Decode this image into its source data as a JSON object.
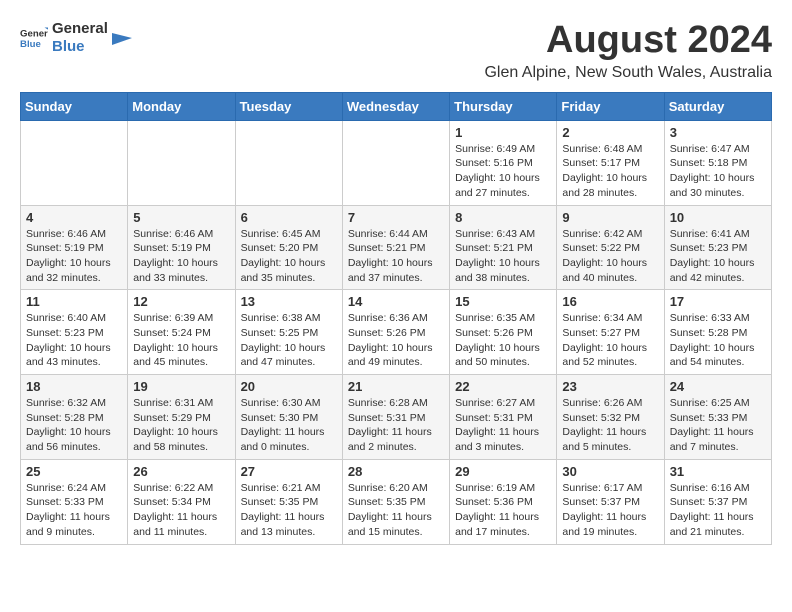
{
  "logo": {
    "line1": "General",
    "line2": "Blue"
  },
  "title": "August 2024",
  "subtitle": "Glen Alpine, New South Wales, Australia",
  "days_of_week": [
    "Sunday",
    "Monday",
    "Tuesday",
    "Wednesday",
    "Thursday",
    "Friday",
    "Saturday"
  ],
  "weeks": [
    [
      {
        "day": "",
        "info": ""
      },
      {
        "day": "",
        "info": ""
      },
      {
        "day": "",
        "info": ""
      },
      {
        "day": "",
        "info": ""
      },
      {
        "day": "1",
        "info": "Sunrise: 6:49 AM\nSunset: 5:16 PM\nDaylight: 10 hours\nand 27 minutes."
      },
      {
        "day": "2",
        "info": "Sunrise: 6:48 AM\nSunset: 5:17 PM\nDaylight: 10 hours\nand 28 minutes."
      },
      {
        "day": "3",
        "info": "Sunrise: 6:47 AM\nSunset: 5:18 PM\nDaylight: 10 hours\nand 30 minutes."
      }
    ],
    [
      {
        "day": "4",
        "info": "Sunrise: 6:46 AM\nSunset: 5:19 PM\nDaylight: 10 hours\nand 32 minutes."
      },
      {
        "day": "5",
        "info": "Sunrise: 6:46 AM\nSunset: 5:19 PM\nDaylight: 10 hours\nand 33 minutes."
      },
      {
        "day": "6",
        "info": "Sunrise: 6:45 AM\nSunset: 5:20 PM\nDaylight: 10 hours\nand 35 minutes."
      },
      {
        "day": "7",
        "info": "Sunrise: 6:44 AM\nSunset: 5:21 PM\nDaylight: 10 hours\nand 37 minutes."
      },
      {
        "day": "8",
        "info": "Sunrise: 6:43 AM\nSunset: 5:21 PM\nDaylight: 10 hours\nand 38 minutes."
      },
      {
        "day": "9",
        "info": "Sunrise: 6:42 AM\nSunset: 5:22 PM\nDaylight: 10 hours\nand 40 minutes."
      },
      {
        "day": "10",
        "info": "Sunrise: 6:41 AM\nSunset: 5:23 PM\nDaylight: 10 hours\nand 42 minutes."
      }
    ],
    [
      {
        "day": "11",
        "info": "Sunrise: 6:40 AM\nSunset: 5:23 PM\nDaylight: 10 hours\nand 43 minutes."
      },
      {
        "day": "12",
        "info": "Sunrise: 6:39 AM\nSunset: 5:24 PM\nDaylight: 10 hours\nand 45 minutes."
      },
      {
        "day": "13",
        "info": "Sunrise: 6:38 AM\nSunset: 5:25 PM\nDaylight: 10 hours\nand 47 minutes."
      },
      {
        "day": "14",
        "info": "Sunrise: 6:36 AM\nSunset: 5:26 PM\nDaylight: 10 hours\nand 49 minutes."
      },
      {
        "day": "15",
        "info": "Sunrise: 6:35 AM\nSunset: 5:26 PM\nDaylight: 10 hours\nand 50 minutes."
      },
      {
        "day": "16",
        "info": "Sunrise: 6:34 AM\nSunset: 5:27 PM\nDaylight: 10 hours\nand 52 minutes."
      },
      {
        "day": "17",
        "info": "Sunrise: 6:33 AM\nSunset: 5:28 PM\nDaylight: 10 hours\nand 54 minutes."
      }
    ],
    [
      {
        "day": "18",
        "info": "Sunrise: 6:32 AM\nSunset: 5:28 PM\nDaylight: 10 hours\nand 56 minutes."
      },
      {
        "day": "19",
        "info": "Sunrise: 6:31 AM\nSunset: 5:29 PM\nDaylight: 10 hours\nand 58 minutes."
      },
      {
        "day": "20",
        "info": "Sunrise: 6:30 AM\nSunset: 5:30 PM\nDaylight: 11 hours\nand 0 minutes."
      },
      {
        "day": "21",
        "info": "Sunrise: 6:28 AM\nSunset: 5:31 PM\nDaylight: 11 hours\nand 2 minutes."
      },
      {
        "day": "22",
        "info": "Sunrise: 6:27 AM\nSunset: 5:31 PM\nDaylight: 11 hours\nand 3 minutes."
      },
      {
        "day": "23",
        "info": "Sunrise: 6:26 AM\nSunset: 5:32 PM\nDaylight: 11 hours\nand 5 minutes."
      },
      {
        "day": "24",
        "info": "Sunrise: 6:25 AM\nSunset: 5:33 PM\nDaylight: 11 hours\nand 7 minutes."
      }
    ],
    [
      {
        "day": "25",
        "info": "Sunrise: 6:24 AM\nSunset: 5:33 PM\nDaylight: 11 hours\nand 9 minutes."
      },
      {
        "day": "26",
        "info": "Sunrise: 6:22 AM\nSunset: 5:34 PM\nDaylight: 11 hours\nand 11 minutes."
      },
      {
        "day": "27",
        "info": "Sunrise: 6:21 AM\nSunset: 5:35 PM\nDaylight: 11 hours\nand 13 minutes."
      },
      {
        "day": "28",
        "info": "Sunrise: 6:20 AM\nSunset: 5:35 PM\nDaylight: 11 hours\nand 15 minutes."
      },
      {
        "day": "29",
        "info": "Sunrise: 6:19 AM\nSunset: 5:36 PM\nDaylight: 11 hours\nand 17 minutes."
      },
      {
        "day": "30",
        "info": "Sunrise: 6:17 AM\nSunset: 5:37 PM\nDaylight: 11 hours\nand 19 minutes."
      },
      {
        "day": "31",
        "info": "Sunrise: 6:16 AM\nSunset: 5:37 PM\nDaylight: 11 hours\nand 21 minutes."
      }
    ]
  ]
}
